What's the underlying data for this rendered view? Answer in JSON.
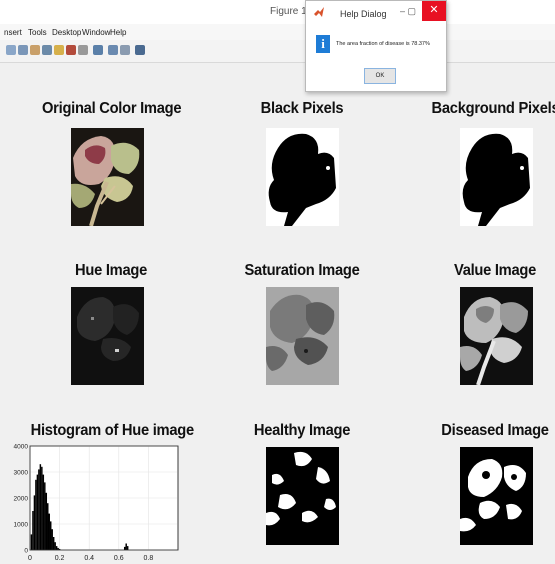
{
  "window": {
    "title": "Figure 1"
  },
  "menu": {
    "items": [
      "nsert",
      "Tools",
      "Desktop",
      "Window",
      "Help"
    ]
  },
  "toolbar": {
    "icons": [
      "zoom-in-icon",
      "zoom-out-icon",
      "pan-icon",
      "rotate-icon",
      "datacursor-icon",
      "brush-icon",
      "link-icon",
      "colorbar-icon",
      "legend-icon",
      "hide-plot-icon",
      "show-plot-icon"
    ]
  },
  "panels": [
    {
      "title": "Original Color Image"
    },
    {
      "title": "Black Pixels"
    },
    {
      "title": "Background Pixels"
    },
    {
      "title": "Hue Image"
    },
    {
      "title": "Saturation Image"
    },
    {
      "title": "Value Image"
    },
    {
      "title": "Histogram of Hue image"
    },
    {
      "title": "Healthy Image"
    },
    {
      "title": "Diseased Image"
    }
  ],
  "dialog": {
    "title": "Help Dialog",
    "message": "The area fraction of disease is 78.37%",
    "ok_label": "OK",
    "close_glyph": "✕",
    "minmax_glyph": "–  ▢"
  },
  "chart_data": {
    "type": "bar",
    "title": "Histogram of Hue image",
    "xlabel": "",
    "ylabel": "",
    "xlim": [
      0,
      1
    ],
    "ylim": [
      0,
      4000
    ],
    "xticks": [
      "0",
      "0.2",
      "0.4",
      "0.6",
      "0.8"
    ],
    "yticks": [
      "0",
      "1000",
      "2000",
      "3000",
      "4000"
    ],
    "grid": true,
    "x": [
      0.01,
      0.02,
      0.03,
      0.04,
      0.05,
      0.06,
      0.07,
      0.08,
      0.09,
      0.1,
      0.11,
      0.12,
      0.13,
      0.14,
      0.15,
      0.16,
      0.17,
      0.18,
      0.19,
      0.2,
      0.64,
      0.65,
      0.66
    ],
    "values": [
      600,
      1500,
      2100,
      2700,
      2900,
      3100,
      3300,
      3200,
      2900,
      2600,
      2200,
      1800,
      1400,
      1100,
      800,
      500,
      300,
      150,
      80,
      40,
      120,
      250,
      150
    ]
  }
}
